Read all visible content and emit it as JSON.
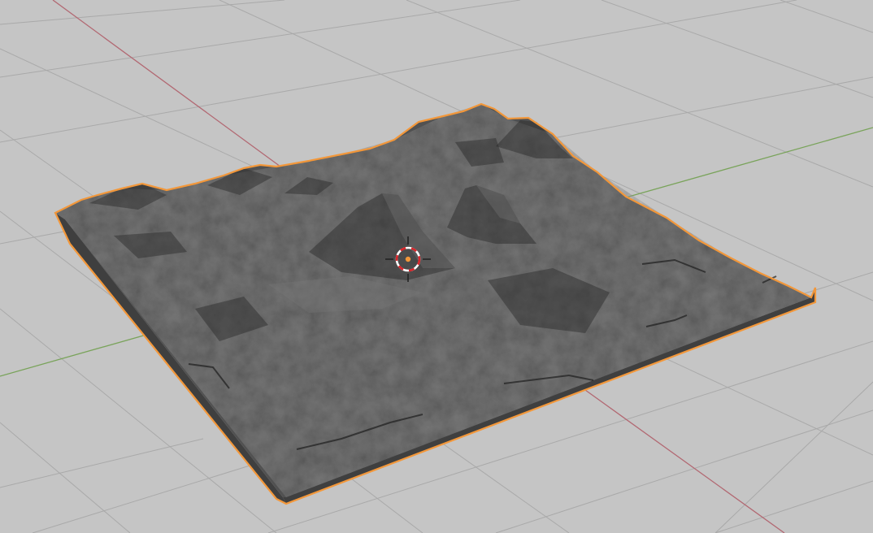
{
  "viewport": {
    "view": "3D Viewport",
    "shading_mode": "solid",
    "background_color": "#c5c5c5",
    "grid_color": "#a9a9a9",
    "x_axis_color": "#b26872",
    "y_axis_color": "#79a35a"
  },
  "scene": {
    "selected_object": {
      "type": "terrain-mesh",
      "selected": true,
      "outline_color": "#f2973a",
      "surface_color": "#515151",
      "side_color": "#3f3f3f"
    },
    "cursor": {
      "icon": "3d-cursor-icon",
      "ring_colors": [
        "#d8262b",
        "#ffffff"
      ],
      "origin_color": "#f2973a"
    }
  }
}
